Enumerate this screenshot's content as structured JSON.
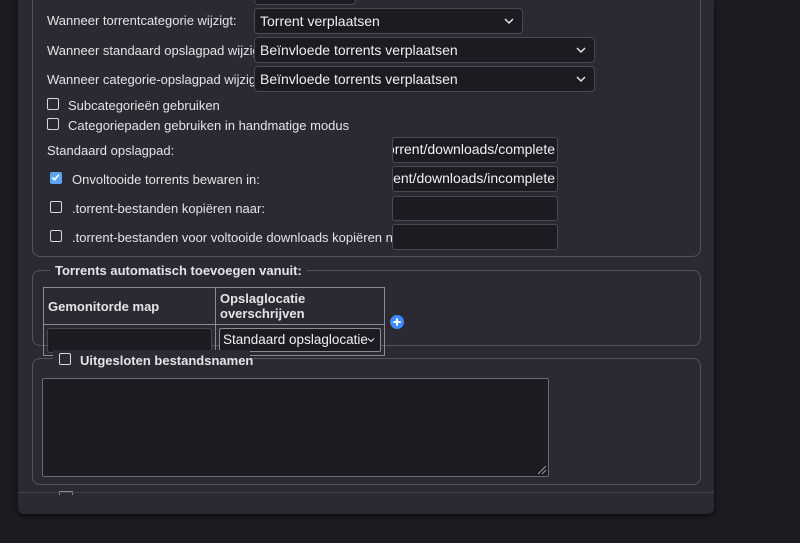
{
  "downloads": {
    "on_category_change": {
      "label": "Wanneer torrentcategorie wijzigt:",
      "value": "Torrent verplaatsen"
    },
    "on_default_path_change": {
      "label": "Wanneer standaard opslagpad wijzigt:",
      "value": "Beïnvloede torrents verplaatsen"
    },
    "on_category_path_change": {
      "label": "Wanneer categorie-opslagpad wijzigt:",
      "value": "Beïnvloede torrents verplaatsen"
    },
    "use_subcategories": {
      "label": "Subcategorieën gebruiken",
      "checked": false
    },
    "category_paths_manual": {
      "label": "Categoriepaden gebruiken in handmatige modus",
      "checked": false
    },
    "default_save_path": {
      "label": "Standaard opslagpad:",
      "value": "/torrent/downloads/complete"
    },
    "incomplete": {
      "label": "Onvoltooide torrents bewaren in:",
      "checked": true,
      "value": "/torrent/downloads/incomplete"
    },
    "copy_torrent_files": {
      "label": ".torrent-bestanden kopiëren naar:",
      "checked": false,
      "value": ""
    },
    "copy_finished_torrent_files": {
      "label": ".torrent-bestanden voor voltooide downloads kopiëren naar:",
      "checked": false,
      "value": ""
    }
  },
  "auto_add": {
    "legend": "Torrents automatisch toevoegen vanuit:",
    "columns": [
      "Gemonitorde map",
      "Opslaglocatie overschrijven"
    ],
    "row": {
      "folder": "",
      "location": "Standaard opslaglocatie"
    },
    "add_icon": "plus-circle-icon"
  },
  "excluded": {
    "legend": "Uitgesloten bestandsnamen",
    "checked": false,
    "value": ""
  },
  "colors": {
    "accent": "#5aa6f3",
    "panel": "#2b2a33",
    "background": "#1c1b22"
  }
}
